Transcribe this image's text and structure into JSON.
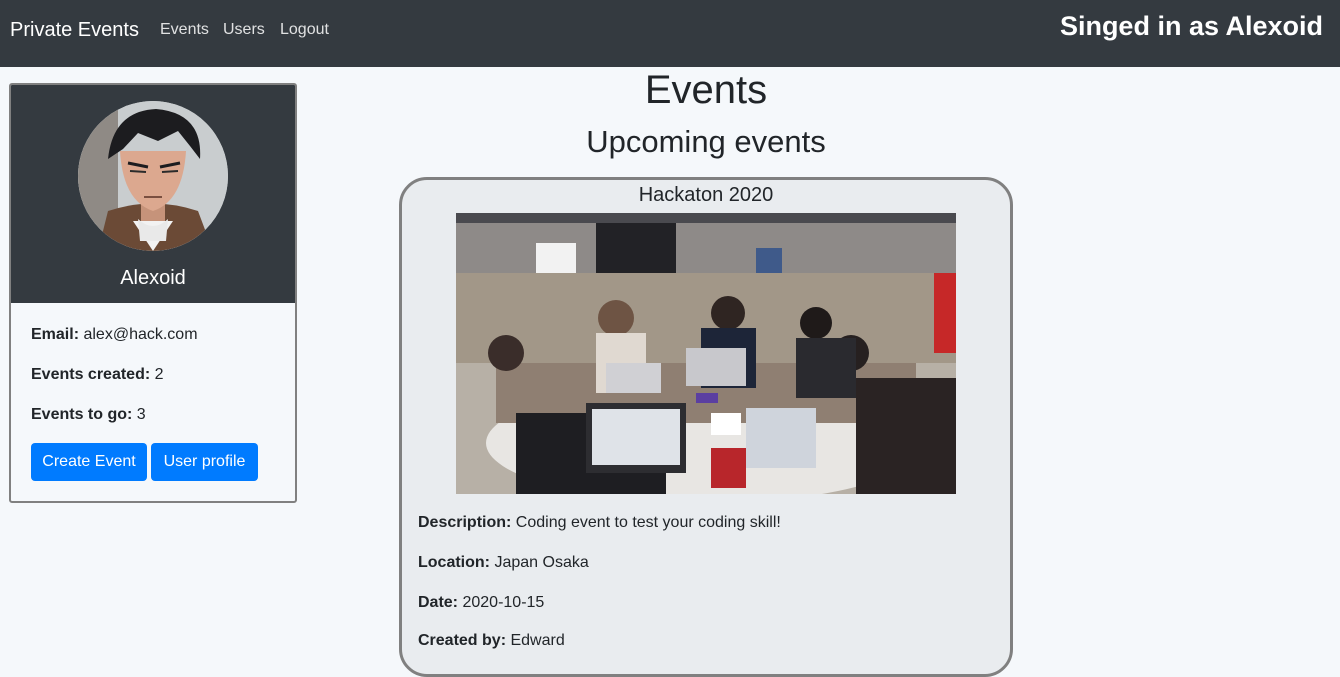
{
  "navbar": {
    "brand": "Private Events",
    "links": [
      "Events",
      "Users",
      "Logout"
    ],
    "signed_in": "Singed in as Alexoid"
  },
  "profile": {
    "name": "Alexoid",
    "email_label": "Email:",
    "email": "alex@hack.com",
    "created_label": "Events created:",
    "created": "2",
    "togo_label": "Events to go:",
    "togo": "3",
    "create_button": "Create Event",
    "profile_button": "User profile"
  },
  "main": {
    "title": "Events",
    "subtitle": "Upcoming events"
  },
  "event": {
    "title": "Hackaton 2020",
    "description_label": "Description:",
    "description": "Coding event to test your coding skill!",
    "location_label": "Location:",
    "location": "Japan Osaka",
    "date_label": "Date:",
    "date": "2020-10-15",
    "creator_label": "Created by:",
    "creator": "Edward"
  }
}
